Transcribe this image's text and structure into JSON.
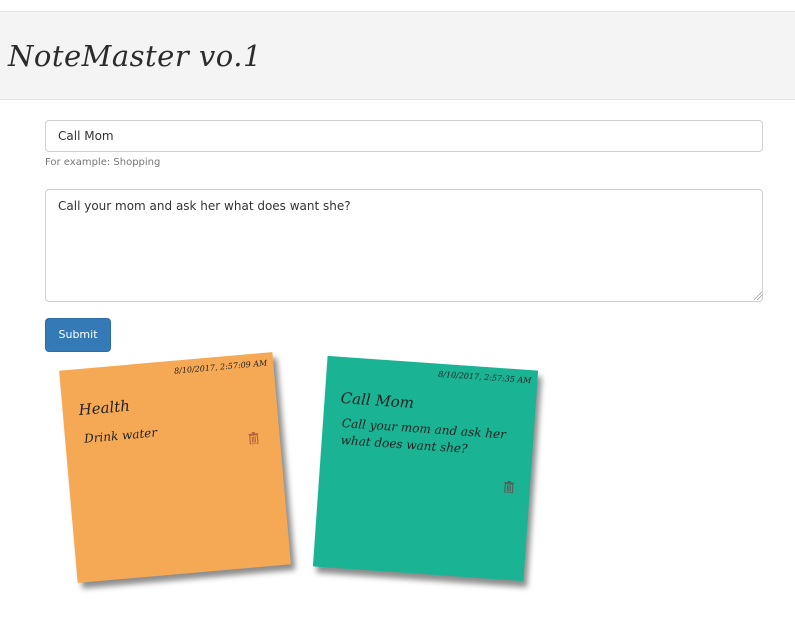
{
  "app": {
    "title": "NoteMaster vo.1"
  },
  "form": {
    "title_value": "Call Mom",
    "help_text": "For example: Shopping",
    "body_value": "Call your mom and ask her what does want she?",
    "submit_label": "Submit"
  },
  "notes": [
    {
      "timestamp": "8/10/2017, 2:57:09 AM",
      "title": "Health",
      "body": "Drink water",
      "color": "#f6a954"
    },
    {
      "timestamp": "8/10/2017, 2:57:35 AM",
      "title": "Call Mom",
      "body": "Call your mom and ask her what does want she?",
      "color": "#1ab394"
    }
  ],
  "icons": {
    "delete": "trash-icon"
  }
}
